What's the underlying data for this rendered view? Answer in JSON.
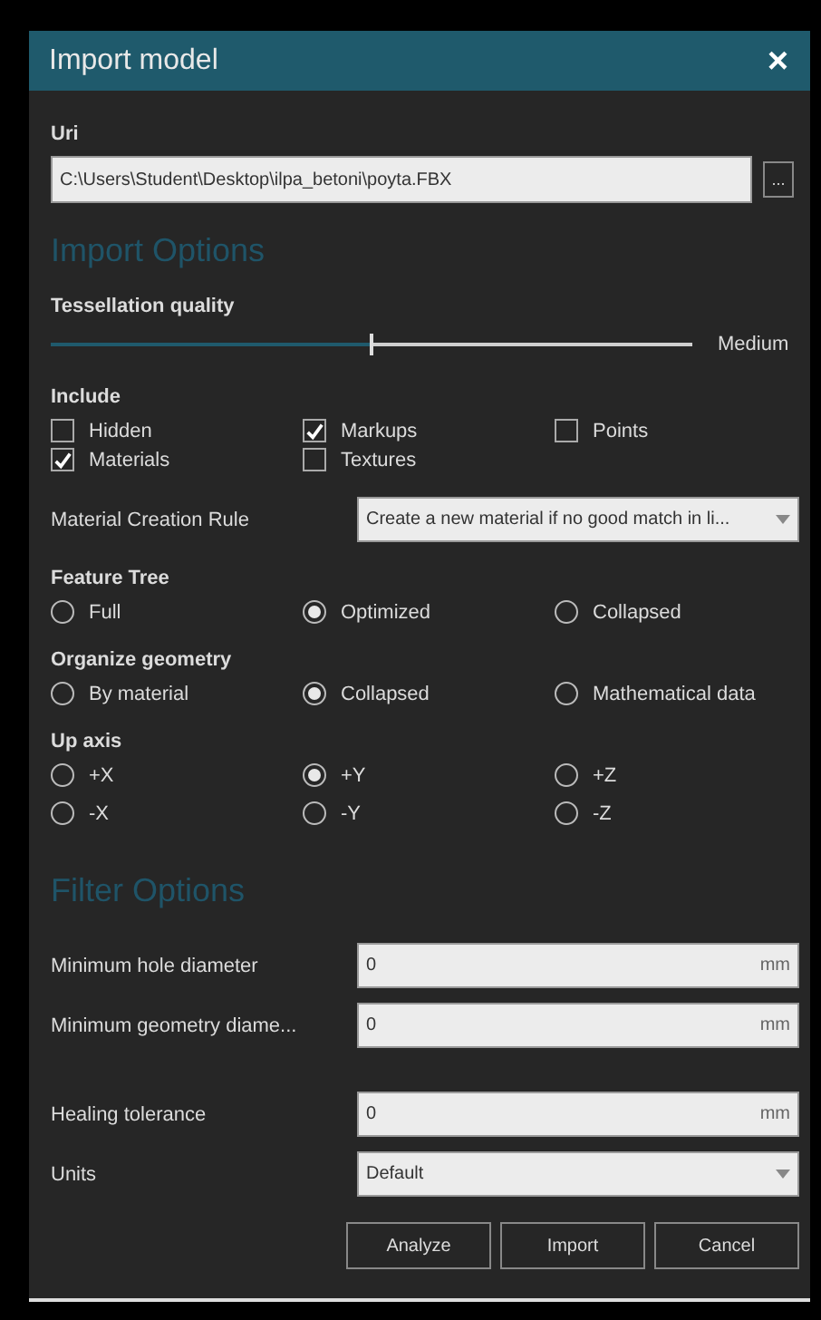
{
  "window": {
    "title": "Import model",
    "close": "×"
  },
  "uri": {
    "label": "Uri",
    "value": "C:\\Users\\Student\\Desktop\\ilpa_betoni\\poyta.FBX",
    "browse": "..."
  },
  "import_options": {
    "heading": "Import Options",
    "tessellation": {
      "label": "Tessellation quality",
      "level": 0.5,
      "reading": "Medium"
    },
    "include": {
      "label": "Include",
      "items": [
        {
          "label": "Hidden",
          "checked": false
        },
        {
          "label": "Markups",
          "checked": true
        },
        {
          "label": "Points",
          "checked": false
        },
        {
          "label": "Materials",
          "checked": true
        },
        {
          "label": "Textures",
          "checked": false
        }
      ]
    },
    "material_rule": {
      "label": "Material Creation Rule",
      "value": "Create a new material if no good match in li..."
    },
    "radio_groups": [
      {
        "label": "Feature Tree",
        "options": [
          {
            "label": "Full",
            "selected": false
          },
          {
            "label": "Optimized",
            "selected": true
          },
          {
            "label": "Collapsed",
            "selected": false
          }
        ]
      },
      {
        "label": "Organize geometry",
        "options": [
          {
            "label": "By material",
            "selected": false
          },
          {
            "label": "Collapsed",
            "selected": true
          },
          {
            "label": "Mathematical data",
            "selected": false
          }
        ]
      },
      {
        "label": "Up axis",
        "options": [
          {
            "label": "+X",
            "selected": false
          },
          {
            "label": "+Y",
            "selected": true
          },
          {
            "label": "+Z",
            "selected": false
          },
          {
            "label": "-X",
            "selected": false
          },
          {
            "label": "-Y",
            "selected": false
          },
          {
            "label": "-Z",
            "selected": false
          }
        ]
      }
    ]
  },
  "filter_options": {
    "heading": "Filter Options",
    "fields": [
      {
        "kind": "number",
        "label": "Minimum hole diameter",
        "value": "0",
        "unit": "mm"
      },
      {
        "kind": "number",
        "label": "Minimum geometry diame...",
        "value": "0",
        "unit": "mm"
      },
      {
        "kind": "number",
        "label": "Healing tolerance",
        "value": "0",
        "unit": "mm"
      },
      {
        "kind": "select",
        "label": "Units",
        "value": "Default"
      }
    ]
  },
  "buttons": [
    "Analyze",
    "Import",
    "Cancel"
  ]
}
